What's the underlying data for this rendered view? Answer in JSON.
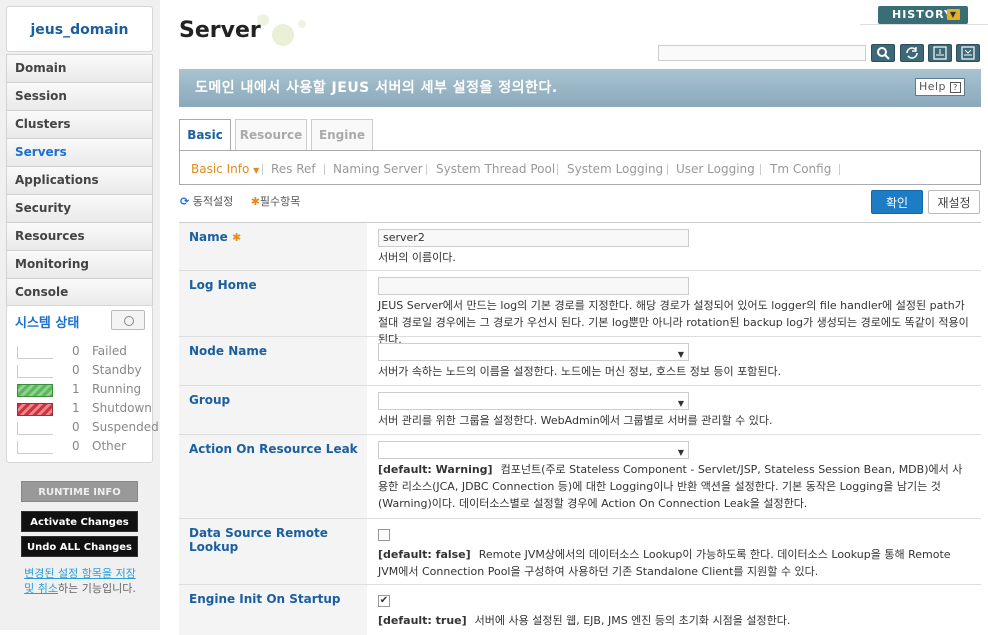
{
  "domain": "jeus_domain",
  "nav": [
    "Domain",
    "Session",
    "Clusters",
    "Servers",
    "Applications",
    "Security",
    "Resources",
    "Monitoring",
    "Console"
  ],
  "active_nav": "Servers",
  "system_status": {
    "title": "시스템 상태",
    "rows": [
      {
        "count": "0",
        "label": "Failed"
      },
      {
        "count": "0",
        "label": "Standby"
      },
      {
        "count": "1",
        "label": "Running"
      },
      {
        "count": "1",
        "label": "Shutdown"
      },
      {
        "count": "0",
        "label": "Suspended"
      },
      {
        "count": "0",
        "label": "Other"
      }
    ]
  },
  "runtime_info": "RUNTIME INFO",
  "activate_changes": "Activate Changes",
  "undo_all_changes": "Undo ALL Changes",
  "undo_note": {
    "link": "변경된 설정 항목을 저장 및 취소",
    "rest": "하는 기능입니다."
  },
  "page_title": "Server",
  "history": "HISTORY",
  "banner": "도메인 내에서 사용할 JEUS 서버의 세부 설정을 정의한다.",
  "help": "Help",
  "tabs": [
    "Basic",
    "Resource",
    "Engine"
  ],
  "subtabs": [
    "Basic Info",
    "Res Ref",
    "Naming Server",
    "System Thread Pool",
    "System Logging",
    "User Logging",
    "Tm Config"
  ],
  "legend": {
    "sync": "동적설정",
    "required": "필수항목"
  },
  "buttons": {
    "ok": "확인",
    "reset": "재설정"
  },
  "fields": {
    "name": {
      "label": "Name",
      "value": "server2",
      "desc": "서버의 이름이다."
    },
    "log_home": {
      "label": "Log Home",
      "value": "",
      "desc": "JEUS Server에서 만드는 log의 기본 경로를 지정한다. 해당 경로가 설정되어 있어도 logger의 file handler에 설정된 path가 절대 경로일 경우에는 그 경로가 우선시 된다. 기본 log뿐만 아니라 rotation된 backup log가 생성되는 경로에도 똑같이 적용이 된다."
    },
    "node_name": {
      "label": "Node Name",
      "value": "",
      "desc": "서버가 속하는 노드의 이름을 설정한다. 노드에는 머신 정보, 호스트 정보 등이 포함된다."
    },
    "group": {
      "label": "Group",
      "value": "",
      "desc": "서버 관리를 위한 그룹을 설정한다. WebAdmin에서 그룹별로 서버를 관리할 수 있다."
    },
    "action_on_resource_leak": {
      "label": "Action On Resource Leak",
      "value": "",
      "default": "[default: Warning]",
      "desc": "컴포넌트(주로 Stateless Component - Servlet/JSP, Stateless Session Bean, MDB)에서 사용한 리소스(JCA, JDBC Connection 등)에 대한 Logging이나 반환 액션을 설정한다. 기본 동작은 Logging을 남기는 것(Warning)이다. 데이터소스별로 설정할 경우에 Action On Connection Leak을 설정한다."
    },
    "data_source_remote_lookup": {
      "label": "Data Source Remote Lookup",
      "checked": false,
      "default": "[default: false]",
      "desc": "Remote JVM상에서의 데이터소스 Lookup이 가능하도록 한다. 데이터소스 Lookup을 통해 Remote JVM에서 Connection Pool을 구성하여 사용하던 기존 Standalone Client를 지원할 수 있다."
    },
    "engine_init_on_startup": {
      "label": "Engine Init On Startup",
      "checked": true,
      "default": "[default: true]",
      "desc": "서버에 사용 설정된 웹, EJB, JMS 엔진 등의 초기화 시점을 설정한다."
    }
  },
  "colors": {
    "accent": "#1b6fd0",
    "active_subtab": "#e08b1d",
    "banner": "#9bb6c6",
    "ok_button": "#1d7cc6"
  }
}
